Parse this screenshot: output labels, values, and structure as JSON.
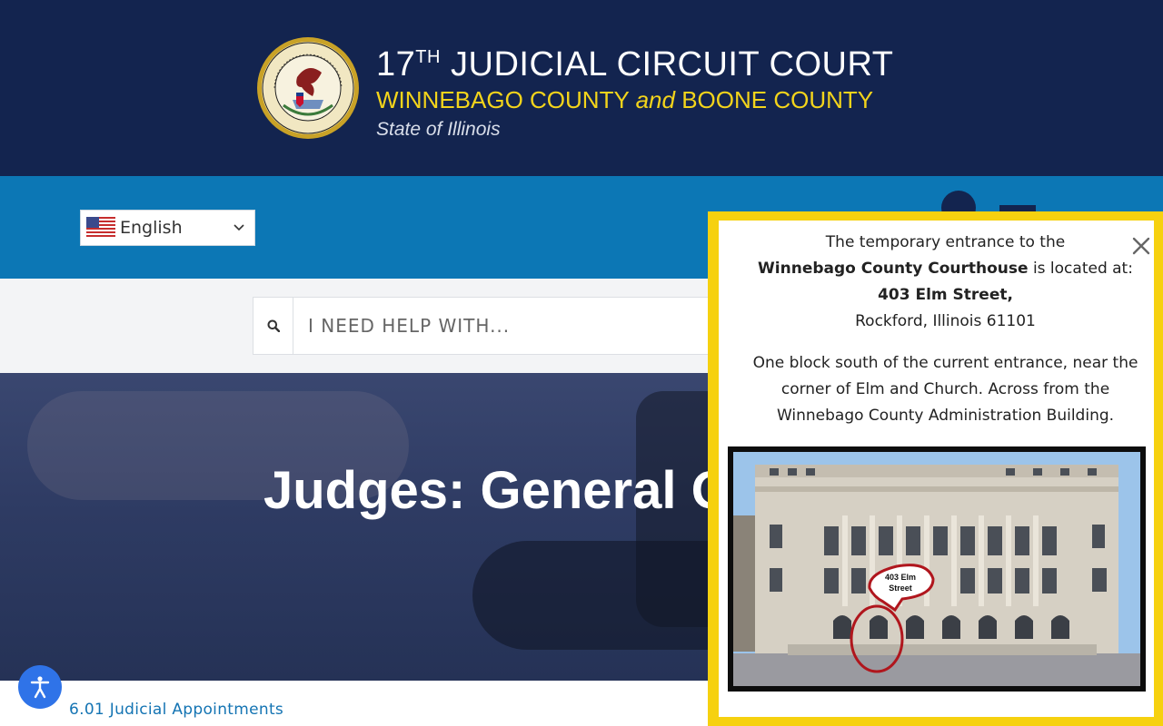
{
  "header": {
    "title_number": "17",
    "title_sup": "TH",
    "title_rest": "JUDICIAL CIRCUIT COURT",
    "county_a": "WINNEBAGO COUNTY",
    "county_and": "and",
    "county_b": "BOONE COUNTY",
    "state": "State of Illinois",
    "seal_icon": "illinois-state-seal-icon"
  },
  "bluebar": {
    "language": "English",
    "social_icon": "facebook-icon",
    "menu_icon": "hamburger-menu-icon"
  },
  "search": {
    "placeholder": "I NEED HELP WITH...",
    "icon": "search-icon"
  },
  "hero": {
    "title": "Judges: General Orders"
  },
  "bottom": {
    "link": "6.01 Judicial Appointments"
  },
  "popup": {
    "line1": "The temporary entrance to the",
    "building": "Winnebago County Courthouse",
    "line2_rest": " is located at:",
    "street": "403 Elm Street,",
    "city": "Rockford, Illinois 61101",
    "para2_l1": "One block south of the current entrance, near the",
    "para2_l2": "corner of Elm and Church. Across from the",
    "para2_l3": "Winnebago County Administration Building.",
    "photo_callout_l1": "403 Elm",
    "photo_callout_l2": "Street"
  },
  "colors": {
    "header_bg": "#13244f",
    "bluebar_bg": "#0c77b5",
    "accent_yellow": "#f3d41b",
    "popup_border": "#f6d10f",
    "link_blue": "#1474b3"
  }
}
